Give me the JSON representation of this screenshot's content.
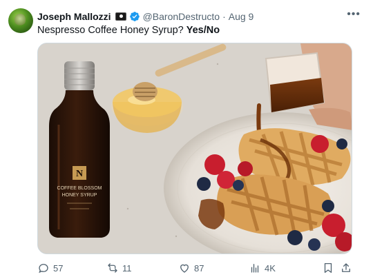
{
  "author": {
    "name": "Joseph Mallozzi",
    "handle": "@BaronDestructo",
    "separator": "·",
    "date": "Aug 9"
  },
  "post": {
    "text": "Nespresso Coffee Honey Syrup?",
    "emphasis": "Yes/No"
  },
  "media": {
    "bottle_label_lines": [
      "COFFEE BLOSSOM",
      "HONEY SYRUP"
    ],
    "bottle_logo": "N"
  },
  "actions": {
    "replies": "57",
    "reposts": "11",
    "likes": "87",
    "views": "4K"
  },
  "icons": {
    "more": "more-horizontal-icon",
    "verified": "verified-badge-icon",
    "reply": "reply-icon",
    "repost": "repost-icon",
    "like": "heart-icon",
    "views": "views-chart-icon",
    "bookmark": "bookmark-icon",
    "share": "share-icon"
  },
  "colors": {
    "verified": "#1d9bf0",
    "muted": "#536471",
    "text": "#0f1419"
  }
}
